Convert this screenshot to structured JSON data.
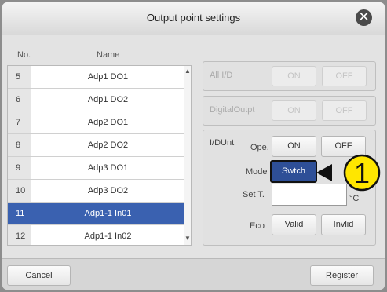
{
  "dialog": {
    "title": "Output point settings"
  },
  "table": {
    "col_no": "No.",
    "col_name": "Name",
    "rows": [
      {
        "no": "5",
        "name": "Adp1 DO1"
      },
      {
        "no": "6",
        "name": "Adp1 DO2"
      },
      {
        "no": "7",
        "name": "Adp2 DO1"
      },
      {
        "no": "8",
        "name": "Adp2 DO2"
      },
      {
        "no": "9",
        "name": "Adp3 DO1"
      },
      {
        "no": "10",
        "name": "Adp3 DO2"
      },
      {
        "no": "11",
        "name": "Adp1-1 In01"
      },
      {
        "no": "12",
        "name": "Adp1-1 In02"
      }
    ],
    "selected_no": "11"
  },
  "all_io": {
    "label": "All I/D",
    "on": "ON",
    "off": "OFF"
  },
  "digital_output": {
    "label": "DigitalOutpt",
    "on": "ON",
    "off": "OFF"
  },
  "io_unit": {
    "label": "I/DUnt",
    "operation_label": "Ope.",
    "on": "ON",
    "off": "OFF",
    "mode_label": "Mode",
    "mode_value": "Swtch",
    "set_temp_label": "Set T.",
    "set_temp_value": "",
    "unit": "°C",
    "eco_label": "Eco",
    "valid": "Valid",
    "invalid": "Invlid"
  },
  "footer": {
    "cancel": "Cancel",
    "register": "Register"
  },
  "callout": {
    "number": "1"
  },
  "colors": {
    "selection": "#3a61b0",
    "accent_button": "#2e4f97",
    "callout": "#ffe600"
  }
}
